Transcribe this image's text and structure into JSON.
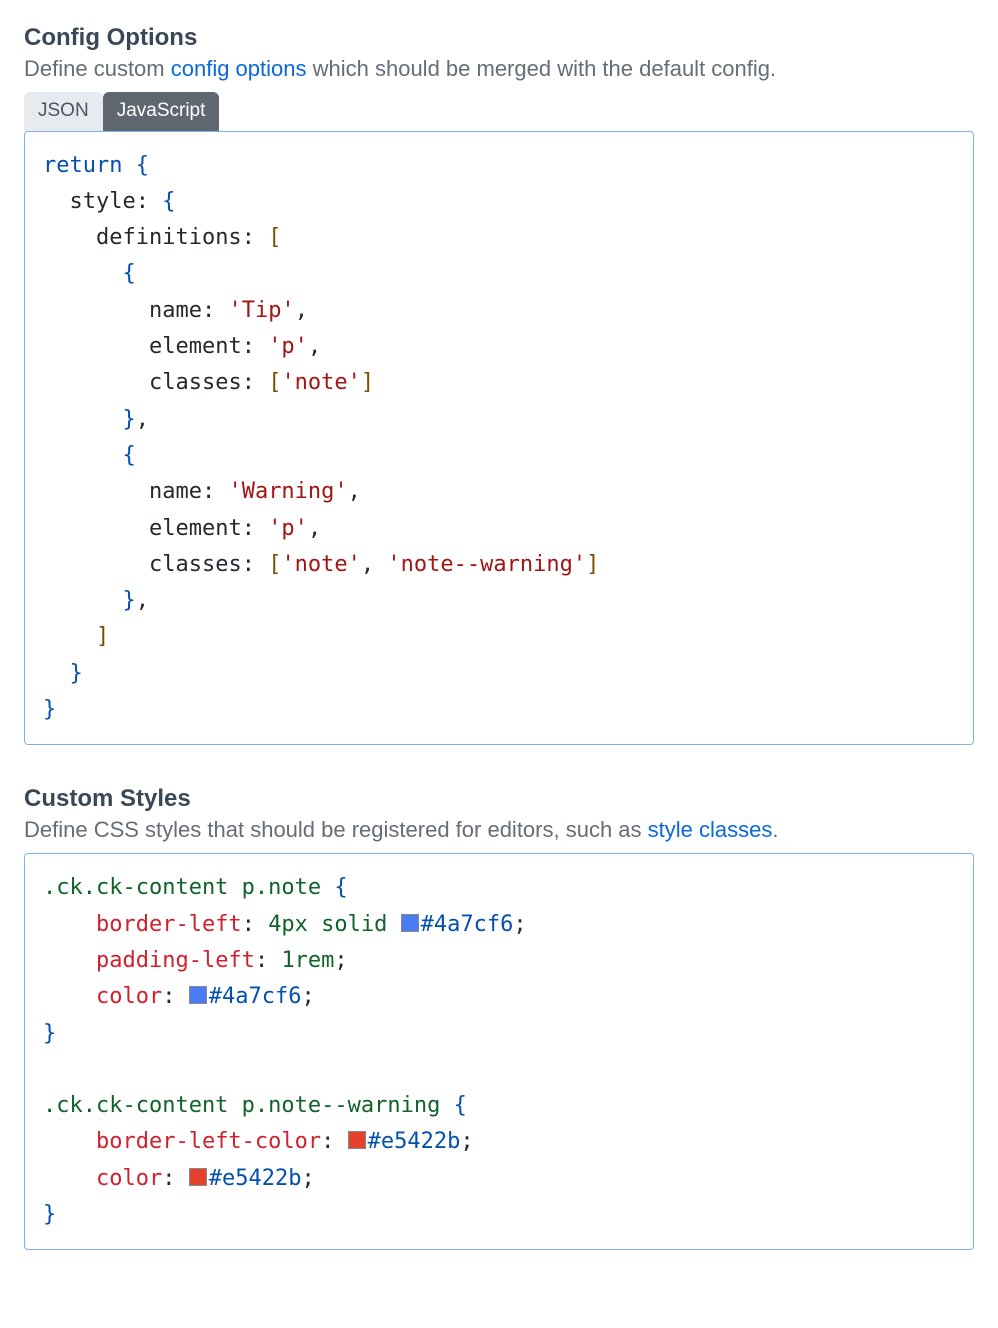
{
  "section1": {
    "heading": "Config Options",
    "desc_pre": "Define custom ",
    "desc_link": "config options",
    "desc_post": " which should be merged with the default config.",
    "tabs": {
      "json": "JSON",
      "js": "JavaScript"
    },
    "code": {
      "return": "return",
      "style": "style",
      "definitions": "definitions",
      "name": "name",
      "element": "element",
      "classes": "classes",
      "tip": "'Tip'",
      "p": "'p'",
      "note": "'note'",
      "warning": "'Warning'",
      "notewarn": "'note--warning'"
    }
  },
  "section2": {
    "heading": "Custom Styles",
    "desc_pre": "Define CSS styles that should be registered for editors, such as ",
    "desc_link": "style classes",
    "desc_post": ".",
    "code": {
      "sel1": ".ck.ck-content p.note",
      "border_left": "border-left",
      "border_left_val": "4px solid",
      "blue": "#4a7cf6",
      "padding_left": "padding-left",
      "padding_val": "1rem",
      "color": "color",
      "sel2": ".ck.ck-content p.note--warning",
      "border_left_color": "border-left-color",
      "red": "#e5422b"
    }
  }
}
